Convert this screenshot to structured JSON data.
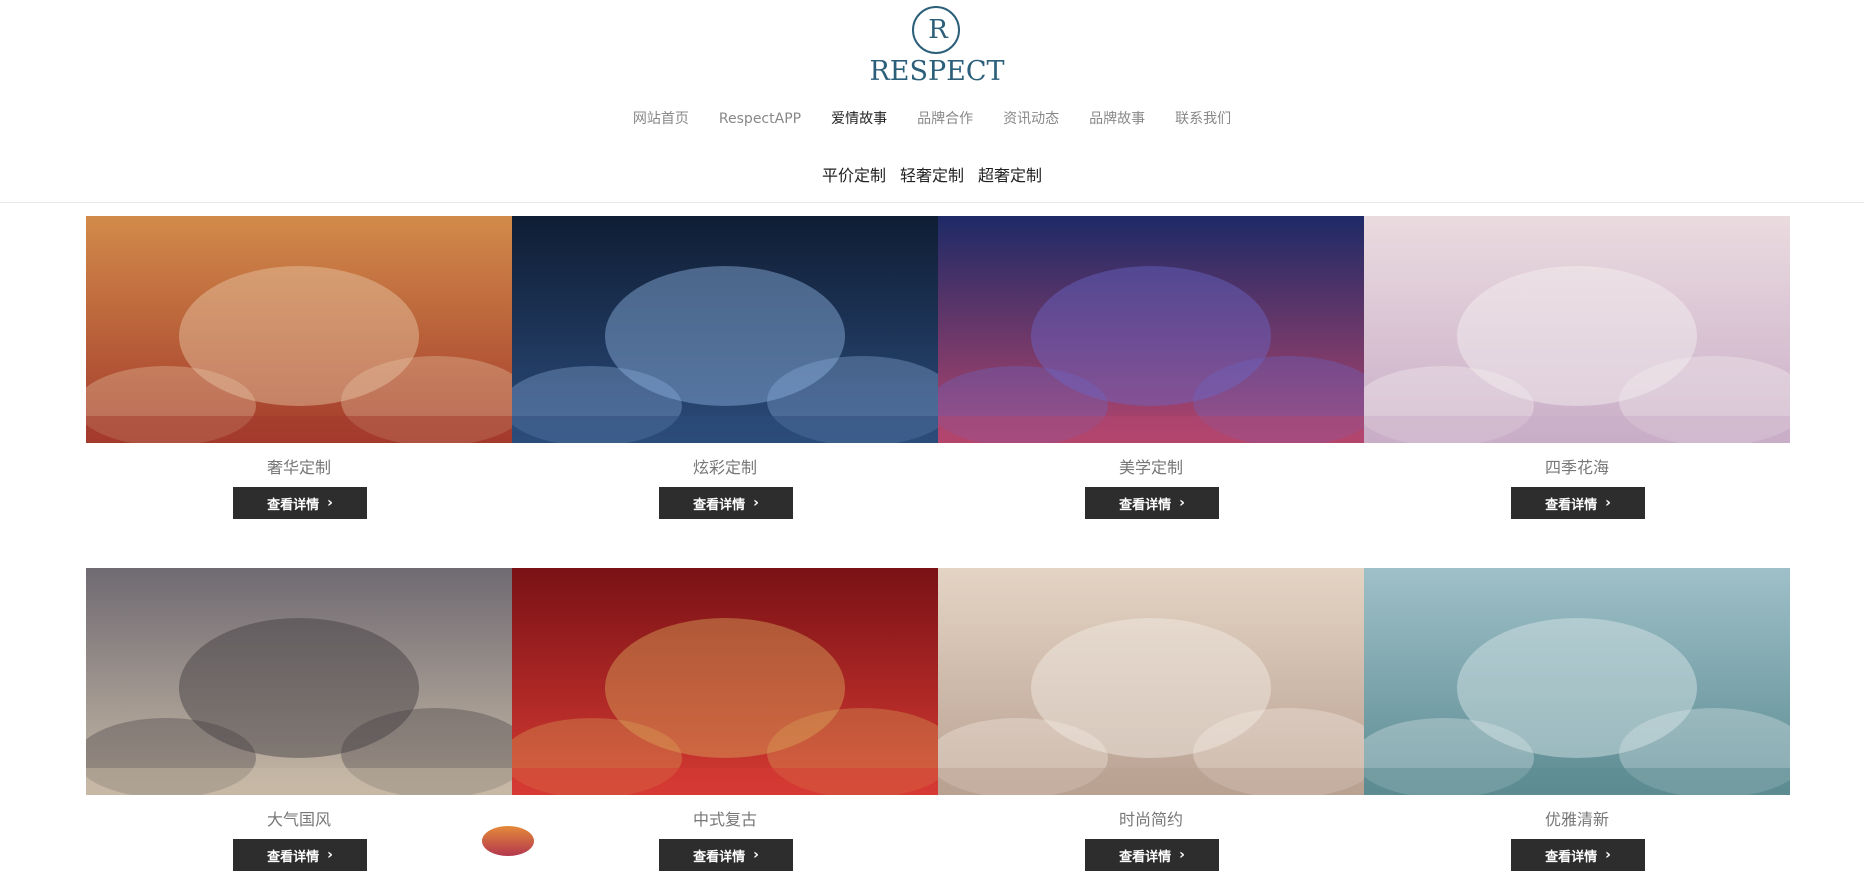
{
  "brand": {
    "logo_letter": "R",
    "logo_text": "RESPECT"
  },
  "nav": [
    {
      "label": "网站首页",
      "active": false
    },
    {
      "label": "RespectAPP",
      "active": false
    },
    {
      "label": "爱情故事",
      "active": true
    },
    {
      "label": "品牌合作",
      "active": false
    },
    {
      "label": "资讯动态",
      "active": false
    },
    {
      "label": "品牌故事",
      "active": false
    },
    {
      "label": "联系我们",
      "active": false
    }
  ],
  "subnav": [
    "平价定制",
    "轻奢定制",
    "超奢定制"
  ],
  "button_label": "查看详情",
  "cards": [
    {
      "title": "奢华定制",
      "palette": [
        "#d28b4a",
        "#a33a2b",
        "#e8c9a8"
      ]
    },
    {
      "title": "炫彩定制",
      "palette": [
        "#0f1d34",
        "#2b4b7a",
        "#8fb3df"
      ]
    },
    {
      "title": "美学定制",
      "palette": [
        "#1d2a66",
        "#b4456d",
        "#6a67c7"
      ]
    },
    {
      "title": "四季花海",
      "palette": [
        "#eadbdf",
        "#c9aec8",
        "#f7f1f2"
      ]
    },
    {
      "title": "大气国风",
      "palette": [
        "#6f6a72",
        "#c7b9a6",
        "#3f3a3e"
      ]
    },
    {
      "title": "中式复古",
      "palette": [
        "#7a1115",
        "#d63a33",
        "#d9a65a"
      ]
    },
    {
      "title": "时尚简约",
      "palette": [
        "#e4d4c4",
        "#b9a192",
        "#f5ede6"
      ]
    },
    {
      "title": "优雅清新",
      "palette": [
        "#9fc0c8",
        "#5c8b92",
        "#dce9eb"
      ]
    }
  ]
}
